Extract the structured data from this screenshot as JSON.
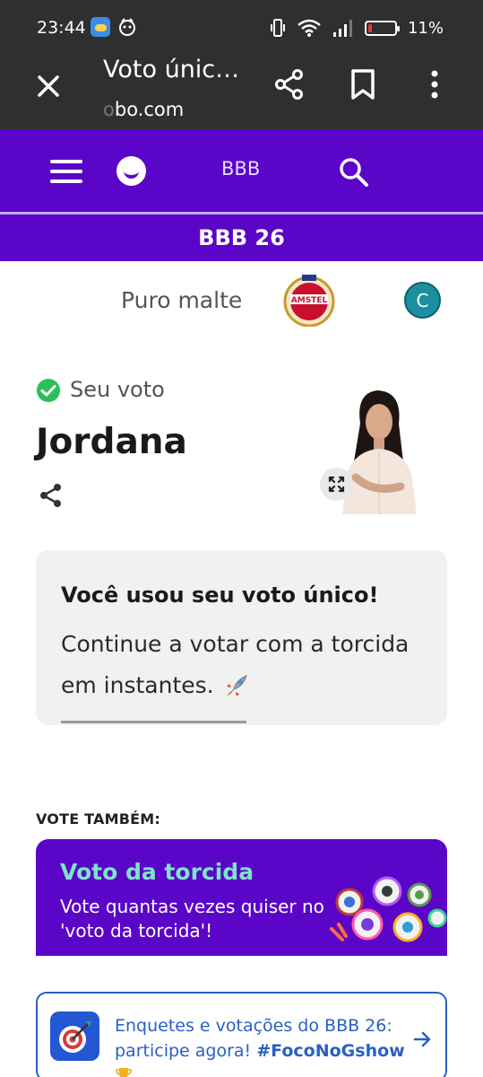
{
  "status_bar": {
    "time": "23:44",
    "battery_percent": "11%"
  },
  "browser": {
    "title": "Voto únic…",
    "url_fade": "o",
    "url": "bo.com"
  },
  "header": {
    "brand": "BBB",
    "avatar_letter": "C"
  },
  "subnav": {
    "label": "BBB 26"
  },
  "sponsor": {
    "text": "Puro malte",
    "logo_name": "AMSTEL"
  },
  "vote": {
    "status_label": "Seu voto",
    "candidate": "Jordana"
  },
  "info_card": {
    "bold": "Você usou seu voto único!",
    "line": "Continue a votar com a torcida em instantes.",
    "progress": 0.45
  },
  "section": {
    "label": "VOTE TAMBÉM:"
  },
  "torcida": {
    "title": "Voto da torcida",
    "description": "Vote quantas vezes quiser no 'voto da torcida'!"
  },
  "promo": {
    "text": "Enquetes e votações do BBB 26: participe agora!",
    "hashtag": "#FocoNoGshow"
  },
  "colors": {
    "brand_purple": "#5a05c8",
    "accent_teal": "#7ce5c6",
    "link_blue": "#2a5fc4"
  }
}
